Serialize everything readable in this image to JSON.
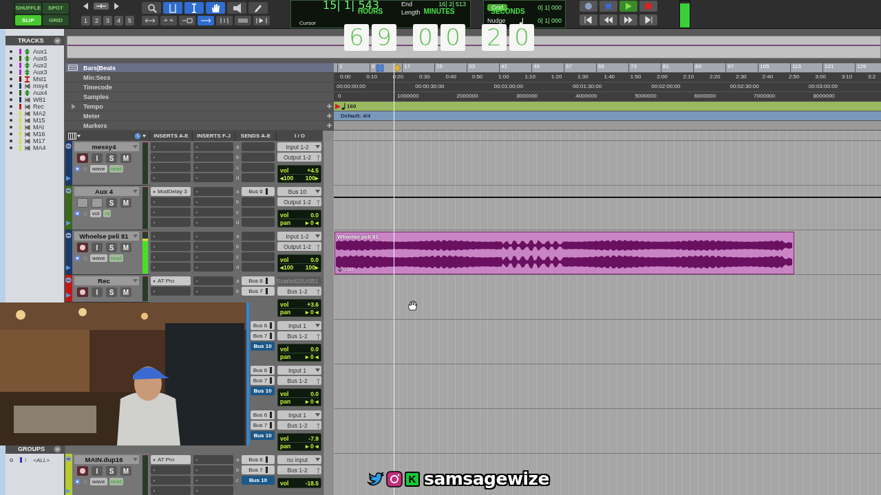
{
  "toolbar": {
    "edit_modes": [
      {
        "label": "SHUFFLE",
        "selected": false
      },
      {
        "label": "SPOT",
        "selected": false
      },
      {
        "label": "SLIP",
        "selected": true
      },
      {
        "label": "GRID",
        "selected": false
      }
    ],
    "zoom_presets": [
      "1",
      "2",
      "3",
      "4",
      "5"
    ],
    "counter": {
      "main": "15| 1| 543",
      "end_label": "End",
      "end": "16| 2| 513",
      "length_label": "Length",
      "cursor_label": "Cursor"
    },
    "grid": {
      "label": "Grid",
      "value": "0| 1| 000",
      "nudge_label": "Nudge",
      "nudge": "0| 1| 000"
    }
  },
  "clock_overlay": [
    {
      "unit": "HOURS",
      "digits": [
        "6",
        "9"
      ]
    },
    {
      "unit": "MINUTES",
      "digits": [
        "0",
        "0"
      ]
    },
    {
      "unit": "SECONDS",
      "digits": [
        "2",
        "0"
      ]
    }
  ],
  "tracks_list": {
    "title": "TRACKS",
    "items": [
      {
        "name": "Aux1",
        "color": "#b020e0",
        "kind": "aux"
      },
      {
        "name": "Aux5",
        "color": "#2f5a1a",
        "kind": "aux"
      },
      {
        "name": "Aux2",
        "color": "#b020e0",
        "kind": "aux"
      },
      {
        "name": "Aux3",
        "color": "#b020e0",
        "kind": "aux"
      },
      {
        "name": "Mst1",
        "color": "#5a0e0e",
        "kind": "master"
      },
      {
        "name": "msy4",
        "color": "#1a3a6a",
        "kind": "audio"
      },
      {
        "name": "Aux4",
        "color": "#2f5a1a",
        "kind": "aux"
      },
      {
        "name": "W81",
        "color": "#1a3a6a",
        "kind": "audio"
      },
      {
        "name": "Rec",
        "color": "#c01818",
        "kind": "audio"
      },
      {
        "name": "MA2",
        "color": "#d4e040",
        "kind": "audio"
      },
      {
        "name": "M15",
        "color": "#d4e040",
        "kind": "audio"
      },
      {
        "name": "MAI",
        "color": "#d4e040",
        "kind": "audio"
      },
      {
        "name": "M16",
        "color": "#d4e040",
        "kind": "audio"
      },
      {
        "name": "M17",
        "color": "#d4e040",
        "kind": "audio"
      },
      {
        "name": "MA4",
        "color": "#d4e040",
        "kind": "audio"
      }
    ]
  },
  "groups": {
    "title": "GROUPS",
    "items": [
      {
        "flag": "!",
        "name": "<ALL>",
        "color": "#3030d0"
      }
    ]
  },
  "rulers": [
    {
      "label": "Bars|Beats",
      "kind": "bars",
      "selected": true,
      "ticks": [
        "1",
        "9",
        "17",
        "25",
        "33",
        "41",
        "49",
        "57",
        "65",
        "73",
        "81",
        "89",
        "97",
        "105",
        "113",
        "121",
        "129"
      ]
    },
    {
      "label": "Min:Secs",
      "kind": "minsecs",
      "selected": false,
      "ticks": [
        "0:00",
        "0:10",
        "0:20",
        "0:30",
        "0:40",
        "0:50",
        "1:00",
        "1:10",
        "1:20",
        "1:30",
        "1:40",
        "1:50",
        "2:00",
        "2:10",
        "2:20",
        "2:30",
        "2:40",
        "2:50",
        "3:00",
        "3:10",
        "3:2"
      ]
    },
    {
      "label": "Timecode",
      "kind": "timecode",
      "selected": false,
      "ticks": [
        "00:00:00:00",
        "00:00:30:00",
        "00:01:00:00",
        "00:01:30:00",
        "00:02:00:00",
        "00:02:30:00",
        "00:03:00:00"
      ]
    },
    {
      "label": "Samples",
      "kind": "samples",
      "selected": false,
      "ticks": [
        "0",
        "1000000",
        "2000000",
        "3000000",
        "4000000",
        "5000000",
        "6000000",
        "7000000",
        "8000000"
      ]
    },
    {
      "label": "Tempo",
      "kind": "tempo",
      "selected": false,
      "expanded": false,
      "value": "160"
    },
    {
      "label": "Meter",
      "kind": "meter",
      "selected": false,
      "value": "Default: 4/4"
    },
    {
      "label": "Markers",
      "kind": "markers",
      "selected": false
    }
  ],
  "mix_header": [
    "INSERTS A-E",
    "INSERTS F-J",
    "SENDS A-E",
    "I / O"
  ],
  "tracks": [
    {
      "kind": "full",
      "name": "messy4",
      "color": "#1a3a6a",
      "level": 0,
      "buttons": [
        {
          "kind": "record"
        },
        {
          "kind": "input",
          "label": "I"
        },
        {
          "kind": "solo",
          "label": "S"
        },
        {
          "kind": "mute",
          "label": "M"
        }
      ],
      "view": {
        "mode": "wave",
        "automation": "read"
      },
      "sends": [
        {
          "slot": "a"
        },
        {
          "slot": "b"
        },
        {
          "slot": "c"
        },
        {
          "slot": "d"
        }
      ],
      "io": {
        "input": "Input 1-2",
        "output": "Output 1-2",
        "vol_label": "vol",
        "vol": "+4.5",
        "pan": {
          "kind": "stereo",
          "left": "◂100",
          "right": "100▸"
        }
      },
      "lane": {
        "kind": "empty"
      }
    },
    {
      "kind": "full",
      "name": "Aux 4",
      "color": "#3a6a1a",
      "level": 0,
      "buttons": [
        {
          "kind": "blank"
        },
        {
          "kind": "blank"
        },
        {
          "kind": "solo",
          "label": "S"
        },
        {
          "kind": "mute",
          "label": "M"
        }
      ],
      "view": {
        "mode": "vol",
        "automation": "rd"
      },
      "inserts": [
        "ModDelay 3"
      ],
      "sends": [
        {
          "slot": "a",
          "name": "Bus 6",
          "selected": false
        },
        {
          "slot": "b"
        },
        {
          "slot": "c"
        },
        {
          "slot": "d"
        }
      ],
      "io": {
        "input": "Bus 10",
        "output": "Output 1-2",
        "vol_label": "vol",
        "vol": "0.0",
        "pan": {
          "kind": "mono",
          "label": "pan",
          "value": "▸ 0 ◂"
        }
      },
      "lane": {
        "kind": "automation"
      }
    },
    {
      "kind": "full",
      "name": "Whoelse peli 81",
      "color": "#1a3a6a",
      "level": 0.86,
      "buttons": [
        {
          "kind": "record"
        },
        {
          "kind": "input",
          "label": "I"
        },
        {
          "kind": "solo",
          "label": "S"
        },
        {
          "kind": "mute",
          "label": "M"
        }
      ],
      "view": {
        "mode": "wave",
        "automation": "read"
      },
      "sends": [
        {
          "slot": "a"
        },
        {
          "slot": "b"
        },
        {
          "slot": "c"
        },
        {
          "slot": "d"
        }
      ],
      "io": {
        "input": "Input 1-2",
        "output": "Output 1-2",
        "vol_label": "vol",
        "vol": "0.0",
        "pan": {
          "kind": "stereo",
          "left": "◂100",
          "right": "100▸"
        }
      },
      "lane": {
        "kind": "clip",
        "name": "Whoelse peli 81",
        "gain": "0 dB"
      }
    },
    {
      "kind": "full",
      "name": "Rec",
      "color": "#c01818",
      "level": 0,
      "buttons": [
        {
          "kind": "record"
        },
        {
          "kind": "input",
          "label": "I"
        },
        {
          "kind": "solo",
          "label": "S"
        },
        {
          "kind": "mute",
          "label": "M"
        }
      ],
      "inserts": [
        "AT Pro"
      ],
      "sends": [
        {
          "slot": "a",
          "name": "Bus 6",
          "selected": false
        },
        {
          "slot": "b",
          "name": "Bus 7",
          "selected": false
        }
      ],
      "io": {
        "input": "Scarlett22USB1",
        "input_disabled": true,
        "output": "Bus 1-2",
        "vol_label": "vol",
        "vol": "+3.6",
        "pan": {
          "kind": "mono",
          "label": "pan",
          "value": "▸ 0 ◂"
        }
      },
      "lane": {
        "kind": "empty"
      }
    },
    {
      "kind": "partial",
      "sends": [
        {
          "name": "Bus 6",
          "selected": false
        },
        {
          "name": "Bus 7",
          "selected": false
        },
        {
          "name": "Bus 10",
          "selected": true
        }
      ],
      "io": {
        "input": "Input 1",
        "output": "Bus 1-2",
        "vol_label": "vol",
        "vol": "0.0",
        "pan": {
          "kind": "mono",
          "label": "pan",
          "value": "▸ 0 ◂"
        }
      },
      "lane": {
        "kind": "empty"
      }
    },
    {
      "kind": "partial",
      "sends": [
        {
          "name": "Bus 6",
          "selected": false
        },
        {
          "name": "Bus 7",
          "selected": false
        },
        {
          "name": "Bus 10",
          "selected": true
        }
      ],
      "io": {
        "input": "Input 1",
        "output": "Bus 1-2",
        "vol_label": "vol",
        "vol": "0.0",
        "pan": {
          "kind": "mono",
          "label": "pan",
          "value": "▸ 0 ◂"
        }
      },
      "lane": {
        "kind": "empty"
      }
    },
    {
      "kind": "partial",
      "sends": [
        {
          "name": "Bus 6",
          "selected": false
        },
        {
          "name": "Bus 7",
          "selected": false
        },
        {
          "name": "Bus 10",
          "selected": true
        }
      ],
      "io": {
        "input": "Input 1",
        "output": "Bus 1-2",
        "vol_label": "vol",
        "vol": "-7.9",
        "pan": {
          "kind": "mono",
          "label": "pan",
          "value": "▸ 0 ◂"
        }
      },
      "lane": {
        "kind": "empty"
      }
    },
    {
      "kind": "full",
      "name": "MAIN.dup16",
      "color": "#b8cc30",
      "level": 0,
      "buttons": [
        {
          "kind": "record"
        },
        {
          "kind": "input",
          "label": "I"
        },
        {
          "kind": "solo",
          "label": "S"
        },
        {
          "kind": "mute",
          "label": "M"
        }
      ],
      "view": {
        "mode": "wave",
        "automation": "read"
      },
      "inserts": [
        "AT Pro"
      ],
      "sends": [
        {
          "slot": "a",
          "name": "Bus 6",
          "selected": false
        },
        {
          "slot": "b",
          "name": "Bus 7",
          "selected": false
        },
        {
          "slot": "c",
          "name": "Bus 10",
          "selected": true
        }
      ],
      "io": {
        "input": "no input",
        "output": "Bus 1-2",
        "vol_label": "vol",
        "vol": "-18.5"
      },
      "lane": {
        "kind": "empty"
      }
    }
  ],
  "social": {
    "icons": [
      {
        "kind": "bird"
      },
      {
        "kind": "camera"
      }
    ],
    "badge": "K",
    "handle": "samsagewize"
  }
}
